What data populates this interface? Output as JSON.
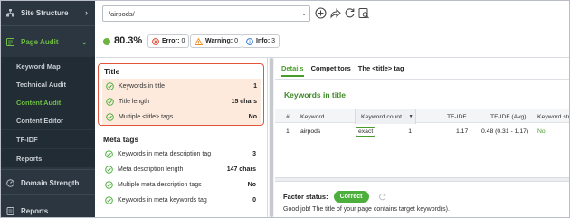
{
  "sidebar": {
    "site_structure": "Site Structure",
    "page_audit": "Page Audit",
    "sub_items": [
      "Keyword Map",
      "Technical Audit",
      "Content Audit",
      "Content Editor",
      "TF-IDF",
      "Reports"
    ],
    "active_sub": "Content Audit",
    "domain_strength": "Domain Strength",
    "reports": "Reports"
  },
  "toolbar": {
    "url_value": "/airpods/"
  },
  "scorebar": {
    "score": "80.3%",
    "error_label": "Error:",
    "error_count": "0",
    "warning_label": "Warning:",
    "warning_count": "0",
    "info_label": "Info:",
    "info_count": "3"
  },
  "factors": {
    "title_group": {
      "heading": "Title",
      "rows": [
        {
          "label": "Keywords in title",
          "value": "1"
        },
        {
          "label": "Title length",
          "value": "15 chars"
        },
        {
          "label": "Multiple <title> tags",
          "value": "No"
        }
      ]
    },
    "meta_group": {
      "heading": "Meta tags",
      "rows": [
        {
          "label": "Keywords in meta description tag",
          "value": "3"
        },
        {
          "label": "Meta description length",
          "value": "147 chars"
        },
        {
          "label": "Multiple meta description tags",
          "value": "No"
        },
        {
          "label": "Keywords in meta keywords tag",
          "value": "0"
        }
      ]
    }
  },
  "details": {
    "tabs": [
      "Details",
      "Competitors",
      "The <title> tag"
    ],
    "active_tab": "Details",
    "section_title": "Keywords in title",
    "columns": [
      "#",
      "Keyword",
      "Keyword count...",
      "TF-IDF",
      "TF-IDF (Avg)",
      "Keyword stu"
    ],
    "rows": [
      {
        "num": "1",
        "keyword": "airpods",
        "match": "exact",
        "count": "1",
        "tfidf": "1.17",
        "tfidf_avg": "0.48 (0.31 - 1.17)",
        "status": "No"
      }
    ],
    "factor_status_label": "Factor status:",
    "factor_status": "Correct",
    "message": "Good job! The title of your page contains target keyword(s)."
  },
  "colors": {
    "sidebar_bg": "#2b3640",
    "accent_green": "#4a9d2d",
    "highlight_border": "#e1553b",
    "row_highlight": "#fdeadd"
  }
}
